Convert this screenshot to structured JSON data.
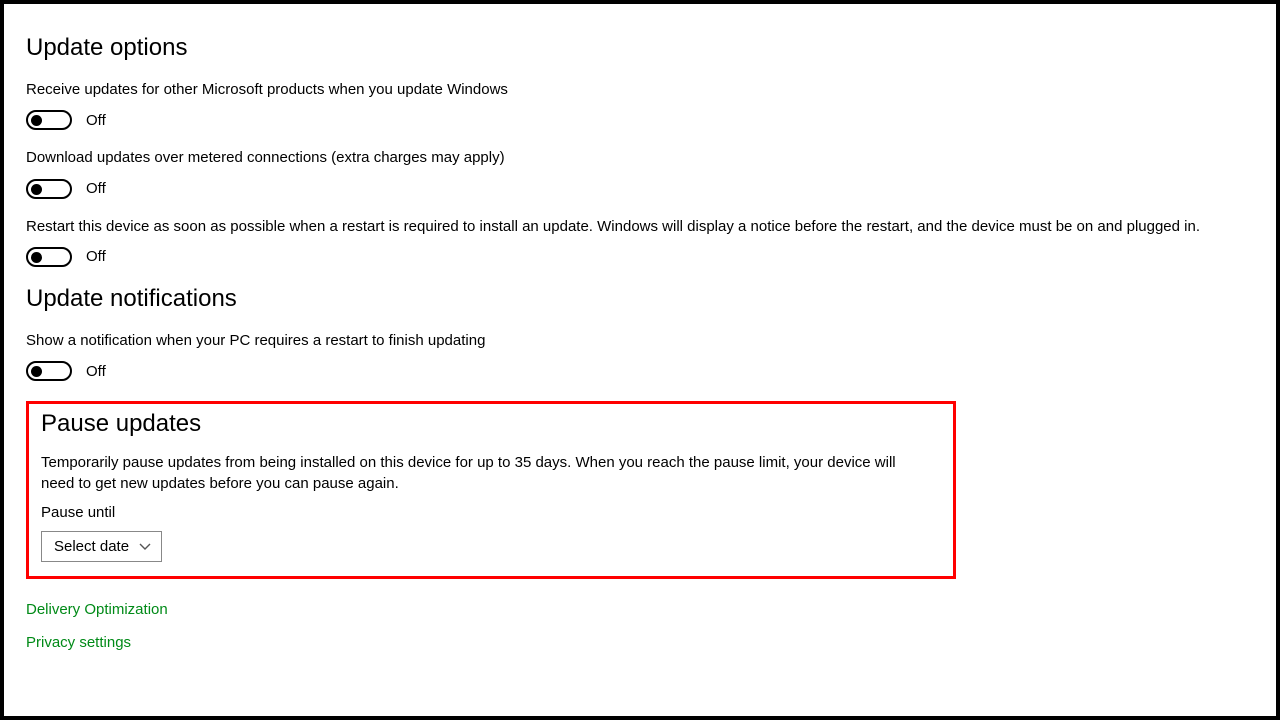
{
  "sections": {
    "update_options": {
      "title": "Update options",
      "items": [
        {
          "desc": "Receive updates for other Microsoft products when you update Windows",
          "state": "Off"
        },
        {
          "desc": "Download updates over metered connections (extra charges may apply)",
          "state": "Off"
        },
        {
          "desc": "Restart this device as soon as possible when a restart is required to install an update. Windows will display a notice before the restart, and the device must be on and plugged in.",
          "state": "Off"
        }
      ]
    },
    "update_notifications": {
      "title": "Update notifications",
      "items": [
        {
          "desc": "Show a notification when your PC requires a restart to finish updating",
          "state": "Off"
        }
      ]
    },
    "pause_updates": {
      "title": "Pause updates",
      "desc": "Temporarily pause updates from being installed on this device for up to 35 days. When you reach the pause limit, your device will need to get new updates before you can pause again.",
      "pause_until_label": "Pause until",
      "combo_value": "Select date"
    }
  },
  "links": {
    "delivery_optimization": "Delivery Optimization",
    "privacy_settings": "Privacy settings"
  }
}
